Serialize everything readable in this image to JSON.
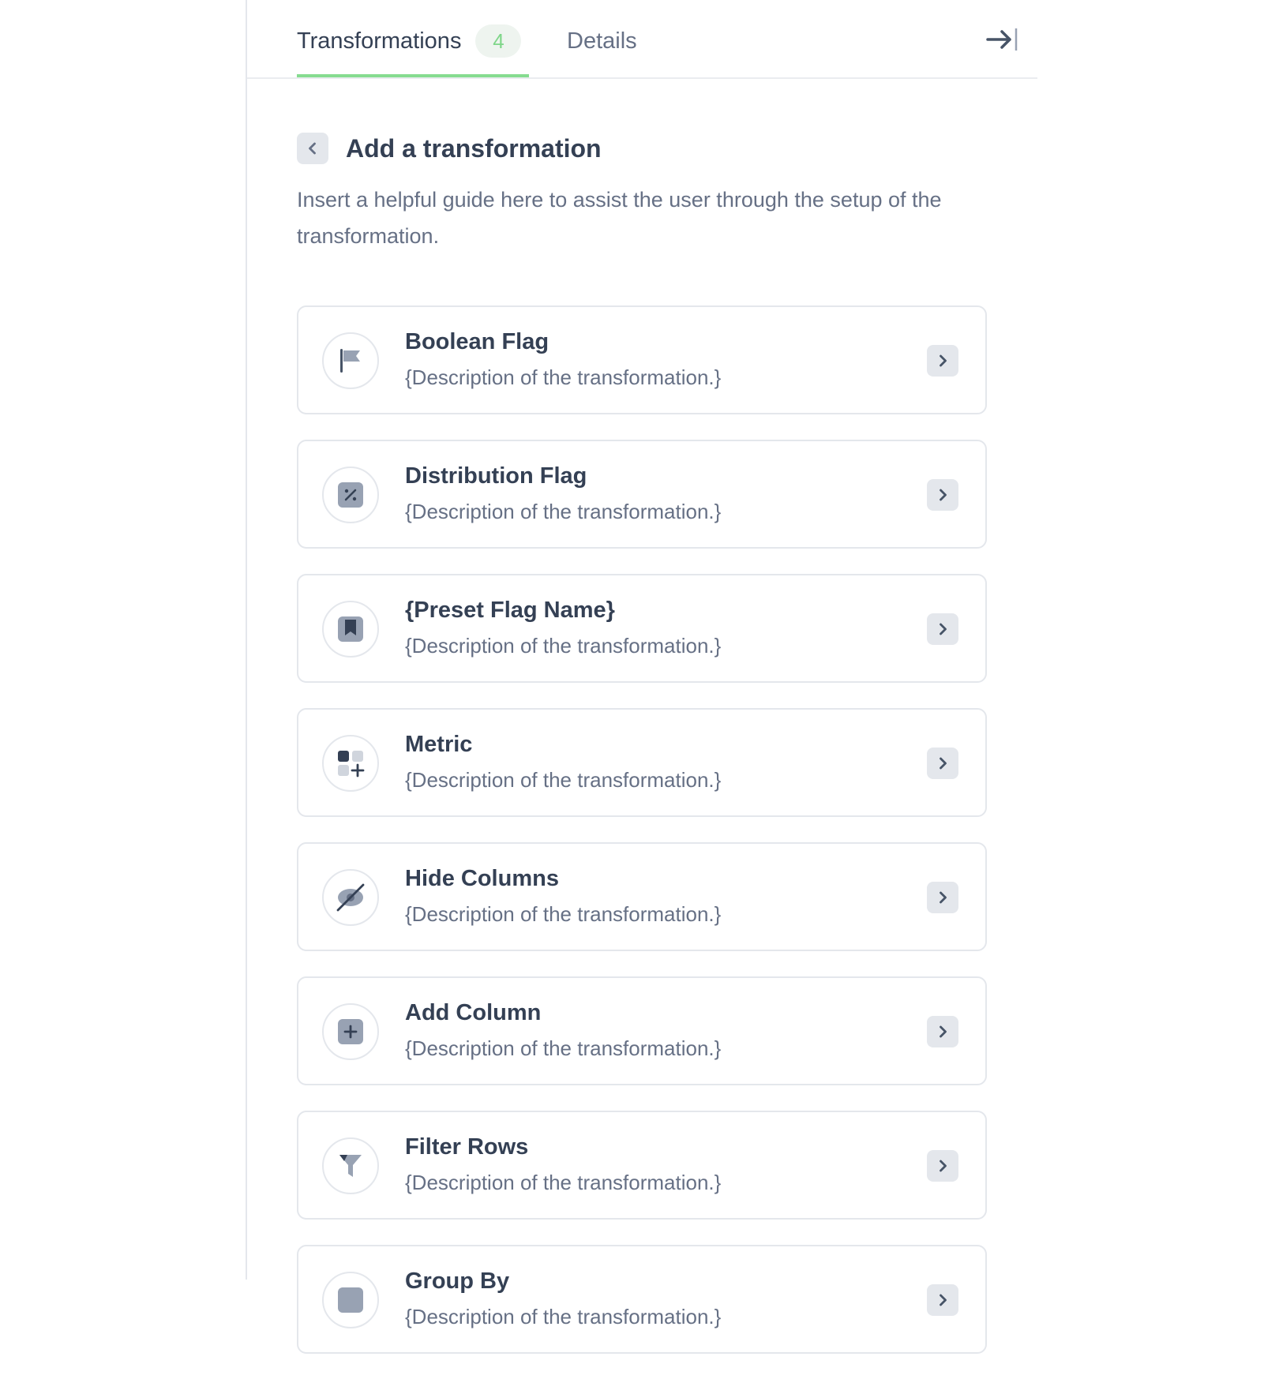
{
  "tabs": {
    "transformations_label": "Transformations",
    "transformations_count": "4",
    "details_label": "Details"
  },
  "header": {
    "title": "Add a transformation",
    "guide": "Insert a helpful guide here to assist the user through the setup of the transformation."
  },
  "items": [
    {
      "title": "Boolean Flag",
      "description": "{Description of the transformation.}",
      "icon": "flag-icon"
    },
    {
      "title": "Distribution Flag",
      "description": "{Description of the transformation.}",
      "icon": "percent-icon"
    },
    {
      "title": "{Preset Flag Name}",
      "description": "{Description of the transformation.}",
      "icon": "bookmark-icon"
    },
    {
      "title": "Metric",
      "description": "{Description of the transformation.}",
      "icon": "metric-add-icon"
    },
    {
      "title": "Hide Columns",
      "description": "{Description of the transformation.}",
      "icon": "eye-off-icon"
    },
    {
      "title": "Add Column",
      "description": "{Description of the transformation.}",
      "icon": "plus-square-icon"
    },
    {
      "title": "Filter Rows",
      "description": "{Description of the transformation.}",
      "icon": "filter-icon"
    },
    {
      "title": "Group By",
      "description": "{Description of the transformation.}",
      "icon": "group-icon"
    }
  ],
  "colors": {
    "accent": "#86dc90",
    "badge_text": "#7fd689",
    "badge_bg": "#eef4ef",
    "border": "#e4e7ec",
    "text_primary": "#344054",
    "text_secondary": "#667085"
  }
}
